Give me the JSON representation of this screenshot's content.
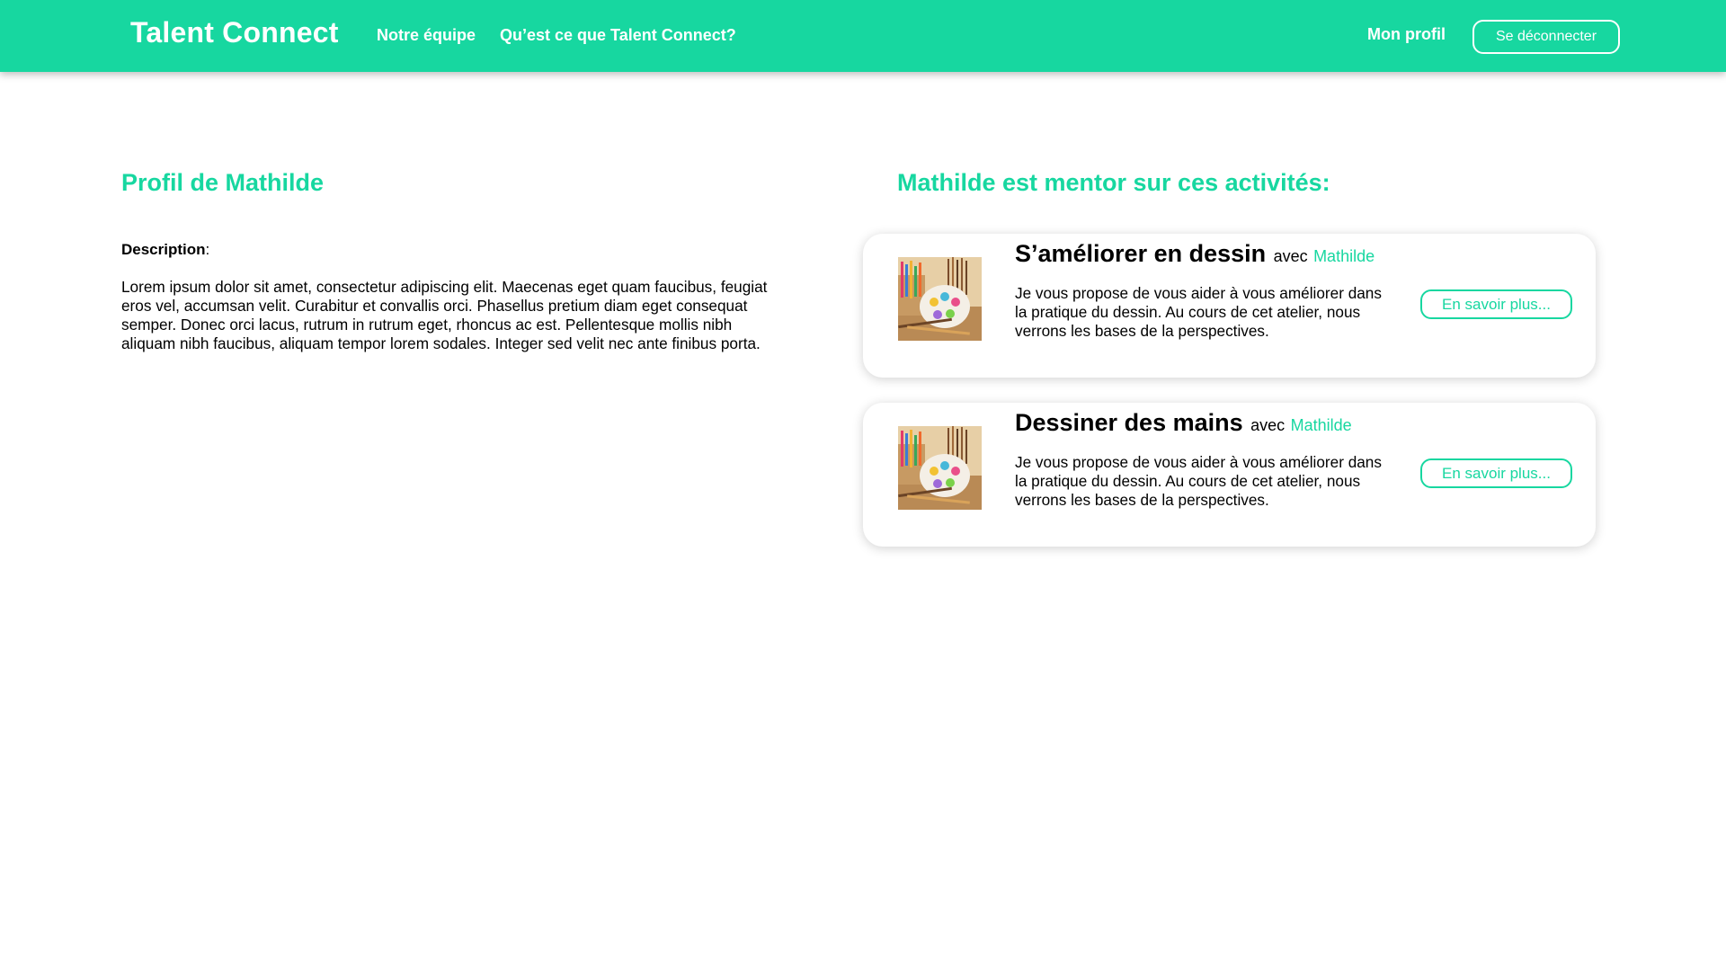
{
  "header": {
    "brand": "Talent Connect",
    "nav": {
      "team": "Notre équipe",
      "about": "Qu’est ce que Talent Connect?",
      "profile": "Mon profil",
      "logout": "Se déconnecter"
    }
  },
  "profile": {
    "title": "Profil de Mathilde",
    "description_label": "Description",
    "description_colon": ":",
    "description": " Lorem ipsum dolor sit amet, consectetur adipiscing elit. Maecenas eget quam faucibus, feugiat eros vel, accumsan velit. Curabitur et convallis orci. Phasellus pretium diam eget consequat semper. Donec orci lacus, rutrum in rutrum eget, rhoncus ac est. Pellentesque mollis nibh aliquam nibh faucibus, aliquam tempor lorem sodales. Integer sed velit nec ante finibus porta."
  },
  "mentor": {
    "title": "Mathilde est mentor sur ces activités:",
    "activities": [
      {
        "title": "S’améliorer en dessin",
        "with": "avec",
        "mentor": "Mathilde",
        "text": "Je vous propose de vous aider à vous améliorer dans la pratique du dessin. Au cours de cet atelier, nous verrons les bases de la perspectives.",
        "button": "En savoir plus..."
      },
      {
        "title": "Dessiner des mains",
        "with": "avec",
        "mentor": "Mathilde",
        "text": "Je vous propose de vous aider à vous améliorer dans la pratique du dessin. Au cours de cet atelier, nous verrons les bases de la perspectives.",
        "button": "En savoir plus..."
      }
    ]
  },
  "colors": {
    "accent": "#17d7a0",
    "text": "#000000",
    "background": "#ffffff"
  },
  "icons": {
    "activity_image": "art-supplies-palette-image"
  }
}
